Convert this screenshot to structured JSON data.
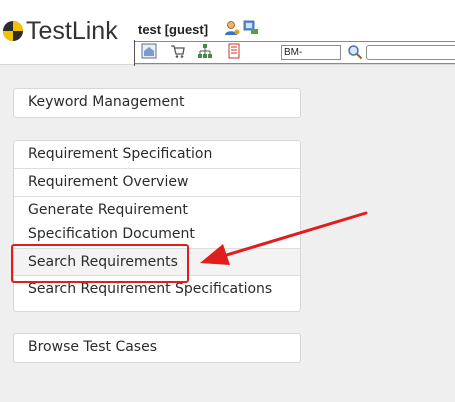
{
  "app": {
    "logo_text": "TestLink"
  },
  "header": {
    "user": "test [guest]",
    "testcase_prefix": "BM-",
    "search_value": ""
  },
  "menu": {
    "keywords": [
      {
        "label": "Keyword Management"
      }
    ],
    "requirements": [
      {
        "label": "Requirement Specification"
      },
      {
        "label": "Requirement Overview"
      },
      {
        "label": "Generate Requirement Specification Document"
      },
      {
        "label": "Search Requirements"
      },
      {
        "label": "Search Requirement Specifications"
      }
    ],
    "testcases": [
      {
        "label": "Browse Test Cases"
      }
    ]
  },
  "annotation": {
    "color": "#e01e1e"
  }
}
